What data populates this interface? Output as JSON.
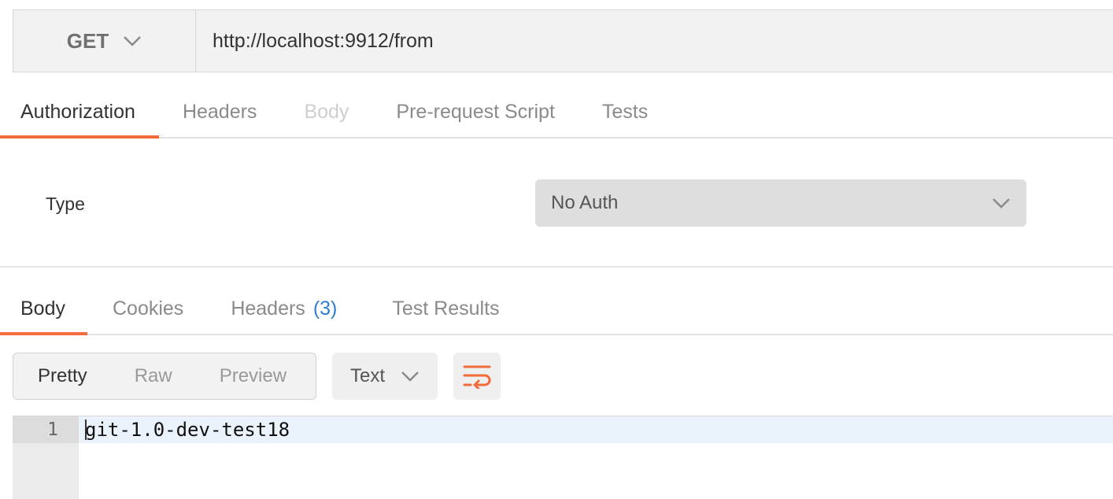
{
  "request": {
    "method": "GET",
    "url": "http://localhost:9912/from"
  },
  "request_tabs": [
    {
      "label": "Authorization",
      "state": "active"
    },
    {
      "label": "Headers",
      "state": "normal"
    },
    {
      "label": "Body",
      "state": "disabled"
    },
    {
      "label": "Pre-request Script",
      "state": "normal"
    },
    {
      "label": "Tests",
      "state": "normal"
    }
  ],
  "auth": {
    "type_label": "Type",
    "selected": "No Auth"
  },
  "response_tabs": [
    {
      "label": "Body",
      "state": "active"
    },
    {
      "label": "Cookies",
      "state": "normal"
    },
    {
      "label": "Headers",
      "count": "(3)",
      "state": "normal"
    },
    {
      "label": "Test Results",
      "state": "normal"
    }
  ],
  "view_modes": [
    {
      "label": "Pretty",
      "active": true
    },
    {
      "label": "Raw",
      "active": false
    },
    {
      "label": "Preview",
      "active": false
    }
  ],
  "format": {
    "selected": "Text"
  },
  "icons": {
    "method_dropdown": "chevron-down-icon",
    "auth_dropdown": "chevron-down-icon",
    "format_dropdown": "chevron-down-icon",
    "wrap": "wrap-lines-icon"
  },
  "colors": {
    "accent": "#f26b3a",
    "count": "#2d7fd3"
  },
  "editor": {
    "lines": [
      {
        "number": "1",
        "text": "git-1.0-dev-test18"
      }
    ]
  }
}
